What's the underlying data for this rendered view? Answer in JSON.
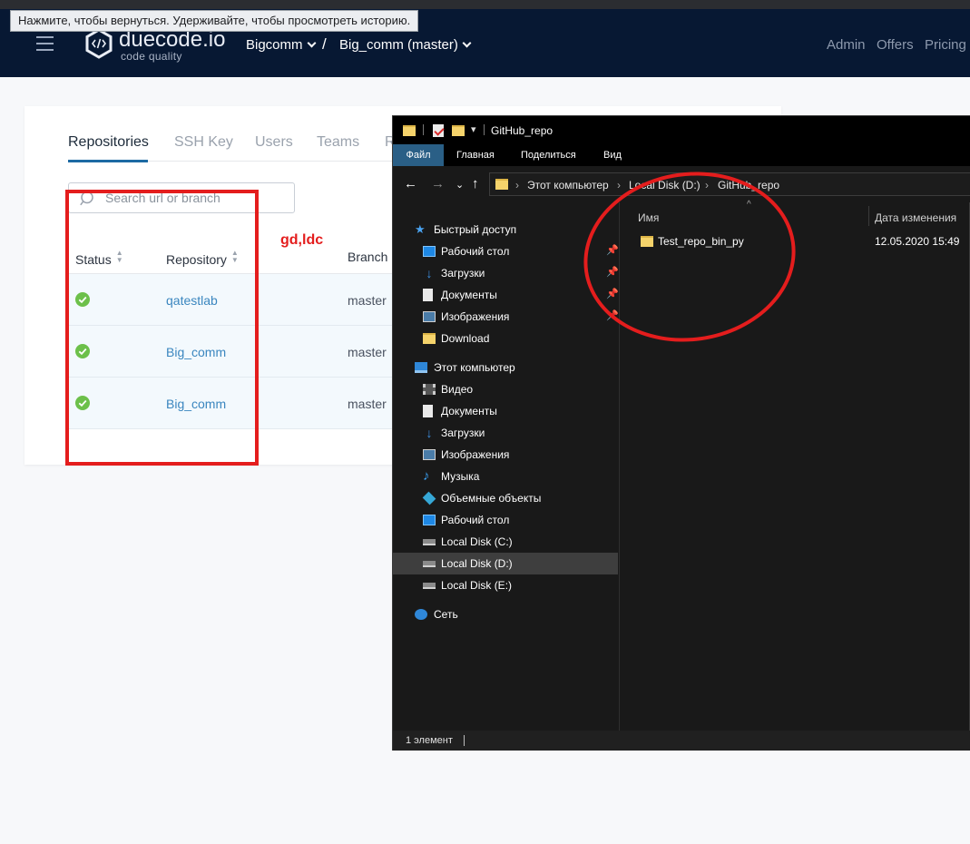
{
  "tooltip": "Нажмите, чтобы вернуться. Удерживайте, чтобы просмотреть историю.",
  "header": {
    "logo_name": "duecode.io",
    "logo_tagline": "code quality",
    "project": "Bigcomm",
    "separator": "/",
    "repo_branch": "Big_comm (master)",
    "links": {
      "admin": "Admin",
      "offers": "Offers",
      "pricing": "Pricing"
    }
  },
  "settings": {
    "tabs": [
      "Repositories",
      "SSH Key",
      "Users",
      "Teams",
      "R"
    ],
    "search_placeholder": "Search url or branch",
    "columns": {
      "status": "Status",
      "repository": "Repository",
      "branch": "Branch"
    },
    "rows": [
      {
        "repository": "qatestlab",
        "branch": "master"
      },
      {
        "repository": "Big_comm",
        "branch": "master"
      },
      {
        "repository": "Big_comm",
        "branch": "master"
      }
    ]
  },
  "annotation_text": "gd,ldc",
  "explorer": {
    "title": "GitHub_repo",
    "ribbon_tabs": [
      "Файл",
      "Главная",
      "Поделиться",
      "Вид"
    ],
    "breadcrumbs": [
      "Этот компьютер",
      "Local Disk (D:)",
      "GitHub_repo"
    ],
    "quick_access": {
      "label": "Быстрый доступ",
      "items": [
        "Рабочий стол",
        "Загрузки",
        "Документы",
        "Изображения",
        "Download"
      ]
    },
    "this_pc": {
      "label": "Этот компьютер",
      "items": [
        "Видео",
        "Документы",
        "Загрузки",
        "Изображения",
        "Музыка",
        "Объемные объекты",
        "Рабочий стол",
        "Local Disk (C:)",
        "Local Disk (D:)",
        "Local Disk (E:)"
      ]
    },
    "network": "Сеть",
    "columns": {
      "name": "Имя",
      "date": "Дата изменения"
    },
    "files": [
      {
        "name": "Test_repo_bin_py",
        "date": "12.05.2020 15:49"
      }
    ],
    "status_count": "1 элемент"
  },
  "colors": {
    "header_bg": "#071833",
    "accent_tab": "#1d6aa3",
    "link": "#3a86bf",
    "success": "#6cc04a",
    "annotation_red": "#e41d1d",
    "explorer_bg": "#191919"
  }
}
